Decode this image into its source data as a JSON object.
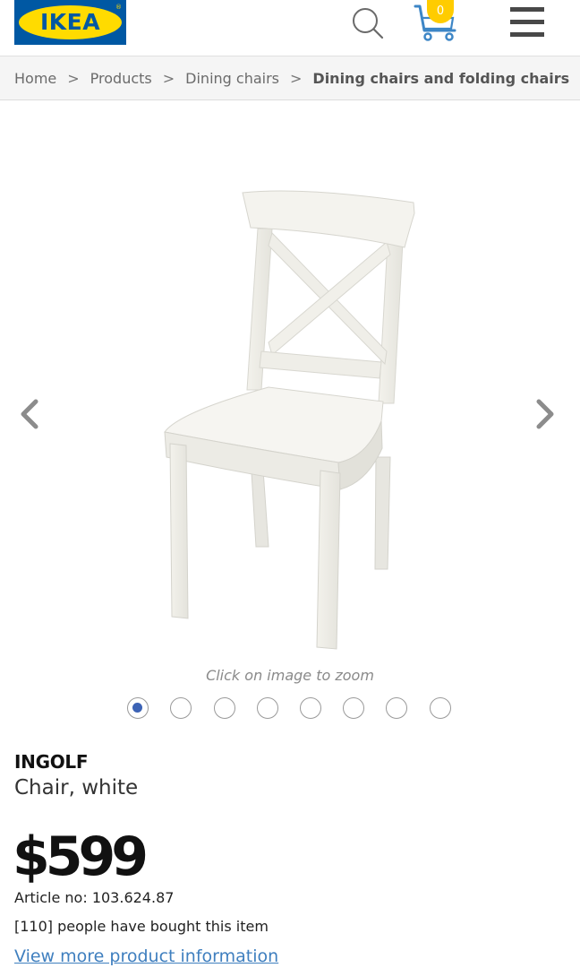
{
  "header": {
    "logo_text": "IKEA",
    "logo_registered": "®",
    "cart_count": "0",
    "colors": {
      "brand_blue": "#0058a3",
      "brand_yellow": "#ffdb00",
      "badge": "#ffcc00"
    },
    "icons": [
      "search-icon",
      "cart-icon",
      "menu-icon"
    ]
  },
  "breadcrumb": {
    "items": [
      "Home",
      "Products",
      "Dining chairs",
      "Dining chairs and folding chairs"
    ],
    "separator": ">"
  },
  "gallery": {
    "zoom_hint": "Click on image to zoom",
    "image_count": 8,
    "active_index": 0,
    "icons": [
      "chevron-left-icon",
      "chevron-right-icon"
    ]
  },
  "product": {
    "name": "INGOLF",
    "description": "Chair, white",
    "price": "$599",
    "article": "Article no: 103.624.87",
    "bought": "[110] people have bought this item",
    "more_info_link": "View more product information"
  }
}
